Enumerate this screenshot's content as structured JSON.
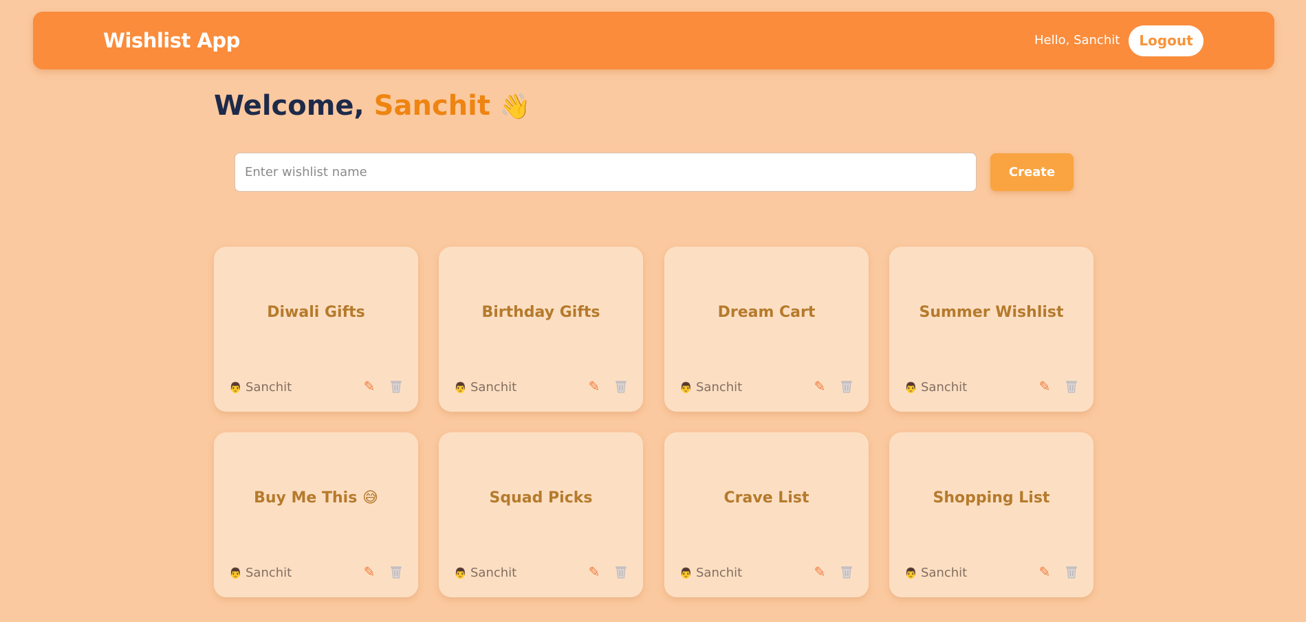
{
  "navbar": {
    "brand": "Wishlist App",
    "greeting": "Hello, Sanchit",
    "logout_label": "Logout"
  },
  "welcome": {
    "prefix": "Welcome,",
    "name": "Sanchit",
    "emoji": "👋"
  },
  "create_form": {
    "placeholder": "Enter wishlist name",
    "value": "",
    "button_label": "Create"
  },
  "wishlists": [
    {
      "title": "Diwali Gifts",
      "owner": "Sanchit"
    },
    {
      "title": "Birthday Gifts",
      "owner": "Sanchit"
    },
    {
      "title": "Dream Cart",
      "owner": "Sanchit"
    },
    {
      "title": "Summer Wishlist",
      "owner": "Sanchit"
    },
    {
      "title": "Buy Me This 😅",
      "owner": "Sanchit"
    },
    {
      "title": "Squad Picks",
      "owner": "Sanchit"
    },
    {
      "title": "Crave List",
      "owner": "Sanchit"
    },
    {
      "title": "Shopping List",
      "owner": "Sanchit"
    }
  ],
  "icons": {
    "owner": "user-icon",
    "edit": "pencil-icon",
    "delete": "trash-icon"
  },
  "colors": {
    "background": "#fbc99f",
    "navbar": "#fa8c3c",
    "accent": "#ee8411",
    "card": "#fcdfc3",
    "card_title": "#b57a2c",
    "create_button": "#f9a441"
  }
}
